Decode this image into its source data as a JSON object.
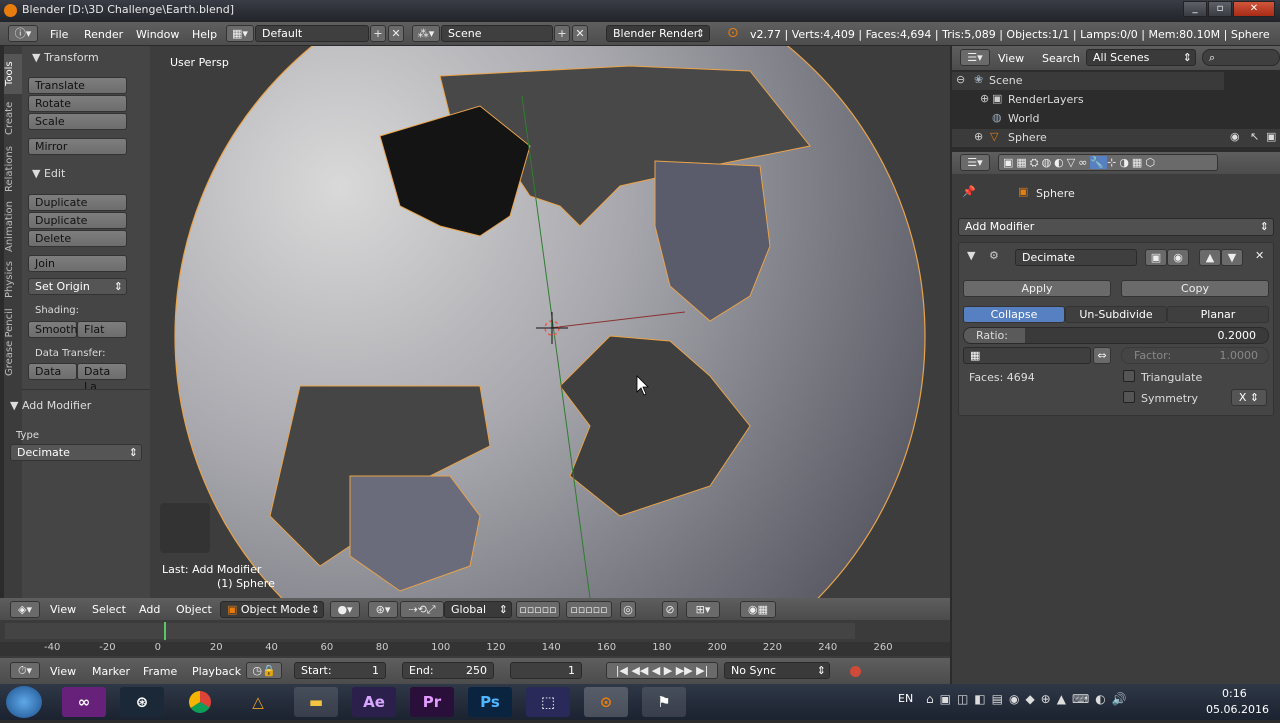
{
  "window": {
    "title": "Blender [D:\\3D Challenge\\Earth.blend]"
  },
  "info": {
    "menus": [
      "File",
      "Render",
      "Window",
      "Help"
    ],
    "layout": "Default",
    "scene": "Scene",
    "engine": "Blender Render",
    "stats": "v2.77 | Verts:4,409 | Faces:4,694 | Tris:5,089 | Objects:1/1 | Lamps:0/0 | Mem:80.10M | Sphere"
  },
  "tabs": [
    "Tools",
    "Create",
    "Relations",
    "Animation",
    "Physics",
    "Grease Pencil"
  ],
  "toolshelf": {
    "transform": "Transform",
    "translate": "Translate",
    "rotate": "Rotate",
    "scale": "Scale",
    "mirror": "Mirror",
    "edit": "Edit",
    "duplicate": "Duplicate",
    "duplicate_linked": "Duplicate Linked",
    "delete": "Delete",
    "join": "Join",
    "set_origin": "Set Origin",
    "shading": "Shading:",
    "smooth": "Smooth",
    "flat": "Flat",
    "data_transfer": "Data Transfer:",
    "data": "Data",
    "data_la": "Data La",
    "add_modifier": "Add Modifier",
    "type_label": "Type",
    "type_value": "Decimate"
  },
  "viewport": {
    "view_name": "User Persp",
    "last_op": "Last: Add Modifier",
    "object_label": "(1) Sphere"
  },
  "view_header": {
    "menus": [
      "View",
      "Select",
      "Add",
      "Object"
    ],
    "mode": "Object Mode",
    "orientation": "Global"
  },
  "timeline": {
    "ticks": [
      "-40",
      "-20",
      "0",
      "20",
      "40",
      "60",
      "80",
      "100",
      "120",
      "140",
      "160",
      "180",
      "200",
      "220",
      "240",
      "260"
    ],
    "menus": [
      "View",
      "Marker",
      "Frame",
      "Playback"
    ],
    "start_label": "Start:",
    "start": "1",
    "end_label": "End:",
    "end": "250",
    "current": "1",
    "sync": "No Sync"
  },
  "outliner": {
    "menus": [
      "View",
      "Search"
    ],
    "filter": "All Scenes",
    "items": [
      "Scene",
      "RenderLayers",
      "World",
      "Sphere"
    ]
  },
  "properties": {
    "breadcrumb": "Sphere",
    "add_modifier": "Add Modifier",
    "modifier": {
      "name": "Decimate",
      "apply": "Apply",
      "copy": "Copy",
      "modes": [
        "Collapse",
        "Un-Subdivide",
        "Planar"
      ],
      "ratio_label": "Ratio:",
      "ratio": "0.2000",
      "factor_label": "Factor:",
      "factor": "1.0000",
      "faces": "Faces: 4694",
      "triangulate": "Triangulate",
      "symmetry": "Symmetry",
      "axis": "X"
    }
  },
  "taskbar": {
    "lang": "EN",
    "time": "0:16",
    "date": "05.06.2016",
    "apps": [
      "Visual Studio",
      "Steam",
      "Chrome",
      "Pulsar",
      "Explorer",
      "Ae",
      "Pr",
      "Ps",
      "Vectorworks",
      "Blender",
      "Game"
    ]
  },
  "colors": {
    "accent": "#5680c2",
    "selection": "#e9a34b",
    "ratio_fill": "#5a5a5a"
  }
}
